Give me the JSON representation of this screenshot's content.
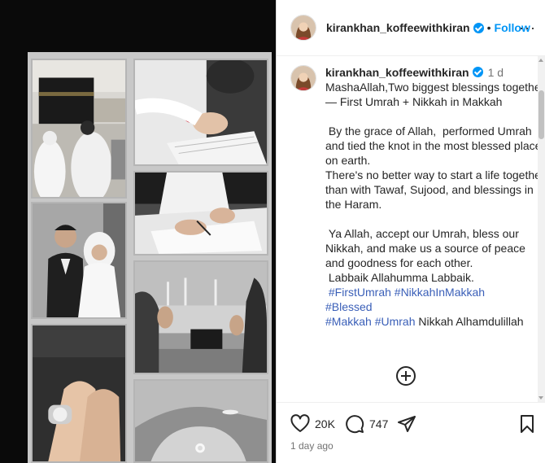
{
  "post": {
    "username": "kirankhan_koffeewithkiran",
    "follow_label": "Follow",
    "separator": "•",
    "more_label": "···",
    "caption_time": "1 d",
    "caption_lines": [
      "MashaAllah,Two biggest blessings together — First Umrah + Nikkah in Makkah",
      "",
      " By the grace of Allah,  performed Umrah and tied the knot in the most blessed place on earth.",
      "There's no better way to start a life together than with Tawaf, Sujood, and blessings in the Haram.",
      "",
      " Ya Allah, accept our Umrah, bless our Nikkah, and make us a source of peace and goodness for each other.",
      " Labbaik Allahumma Labbaik."
    ],
    "hashtag_line_1": " #FirstUmrah #NikkahInMakkah",
    "hashtag_line_2": "#Blessed",
    "hashtag_line_3a": "#Makkah #Umrah",
    "caption_tail": " Nikkah Alhamdulillah",
    "likes": "20K",
    "comments": "747",
    "time_ago": "1 day ago"
  },
  "icons": {
    "verified": "verified-badge-icon",
    "like": "heart-icon",
    "comment": "comment-bubble-icon",
    "share": "paper-plane-icon",
    "save": "bookmark-icon",
    "more_comments": "plus-circle-icon"
  },
  "colors": {
    "accent": "#0095f6",
    "hashtag": "#3a5fb8",
    "muted": "#737373",
    "media_bg": "#0a0a0a"
  }
}
